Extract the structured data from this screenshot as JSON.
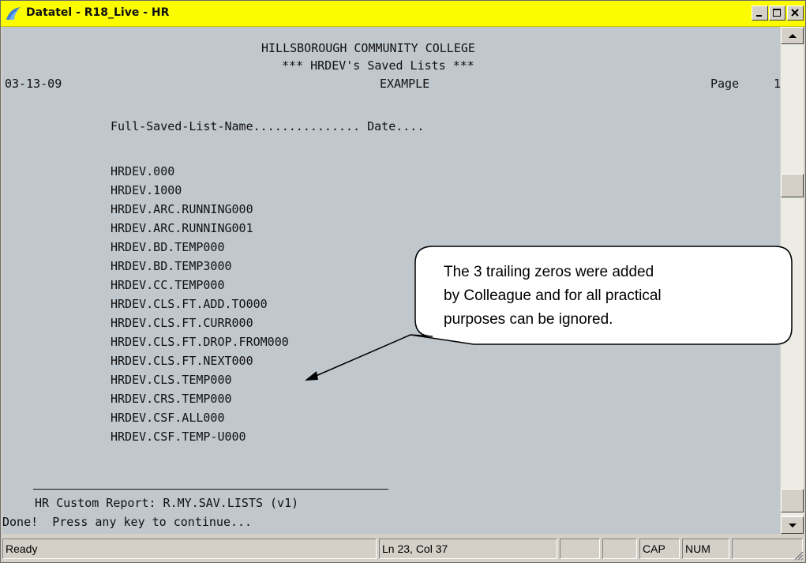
{
  "window": {
    "title": "Datatel - R18_Live - HR",
    "title_color": "#fcfc00"
  },
  "terminal": {
    "header_college": "HILLSBOROUGH COMMUNITY COLLEGE",
    "header_list_title": "*** HRDEV's Saved Lists ***",
    "date": "03-13-09",
    "report_label": "EXAMPLE",
    "page_label": "Page",
    "page_number": "1",
    "column_header": "Full-Saved-List-Name............... Date....",
    "saved_lists": [
      "HRDEV.000",
      "HRDEV.1000",
      "HRDEV.ARC.RUNNING000",
      "HRDEV.ARC.RUNNING001",
      "HRDEV.BD.TEMP000",
      "HRDEV.BD.TEMP3000",
      "HRDEV.CC.TEMP000",
      "HRDEV.CLS.FT.ADD.TO000",
      "HRDEV.CLS.FT.CURR000",
      "HRDEV.CLS.FT.DROP.FROM000",
      "HRDEV.CLS.FT.NEXT000",
      "HRDEV.CLS.TEMP000",
      "HRDEV.CRS.TEMP000",
      "HRDEV.CSF.ALL000",
      "HRDEV.CSF.TEMP-U000"
    ],
    "footer_report": "HR Custom Report: R.MY.SAV.LISTS (v1)",
    "footer_prompt": "Done!  Press any key to continue...",
    "background": "#c0c7cd"
  },
  "callout": {
    "text_lines": [
      "The 3 trailing zeros were added",
      "by Colleague and for all practical",
      "purposes can be ignored."
    ]
  },
  "statusbar": {
    "ready": "Ready",
    "position": "Ln 23, Col 37",
    "cap": "CAP",
    "num": "NUM"
  },
  "icons": [
    "app-logo-icon",
    "minimize-icon",
    "maximize-icon",
    "close-icon",
    "scroll-up-icon",
    "scroll-down-icon",
    "resize-grip-icon"
  ]
}
